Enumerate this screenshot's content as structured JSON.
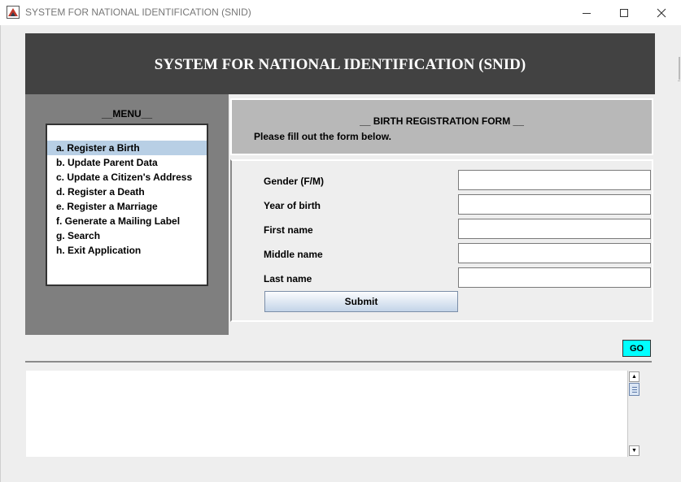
{
  "window": {
    "title": "SYSTEM FOR NATIONAL IDENTIFICATION (SNID)",
    "icons": [
      "app-icon",
      "minimize-icon",
      "maximize-icon",
      "close-icon"
    ]
  },
  "header": {
    "title": "SYSTEM FOR NATIONAL IDENTIFICATION (SNID)"
  },
  "menu": {
    "title": "__MENU__",
    "selected_index": 0,
    "items": [
      {
        "label": "a.  Register a Birth"
      },
      {
        "label": "b.  Update Parent Data"
      },
      {
        "label": "c.  Update a Citizen's Address"
      },
      {
        "label": "d.  Register a Death"
      },
      {
        "label": "e.  Register a Marriage"
      },
      {
        "label": "f.  Generate a Mailing Label"
      },
      {
        "label": "g.  Search"
      },
      {
        "label": "h.  Exit Application"
      }
    ]
  },
  "form": {
    "title": "__ BIRTH  REGISTRATION FORM __",
    "subtitle": "Please fill out the form below.",
    "fields": [
      {
        "label": "Gender (F/M)",
        "value": ""
      },
      {
        "label": "Year of birth",
        "value": ""
      },
      {
        "label": "First name",
        "value": ""
      },
      {
        "label": "Middle name",
        "value": ""
      },
      {
        "label": "Last name",
        "value": ""
      }
    ],
    "submit_label": "Submit"
  },
  "go_label": "GO",
  "output": {
    "text": ""
  },
  "colors": {
    "header_bg": "#424242",
    "menu_panel_bg": "#7f7f7f",
    "form_header_bg": "#b8b8b8",
    "selected_item_bg": "#b8cfe5",
    "go_button_bg": "#00ffff",
    "window_bg": "#eeeeee"
  }
}
